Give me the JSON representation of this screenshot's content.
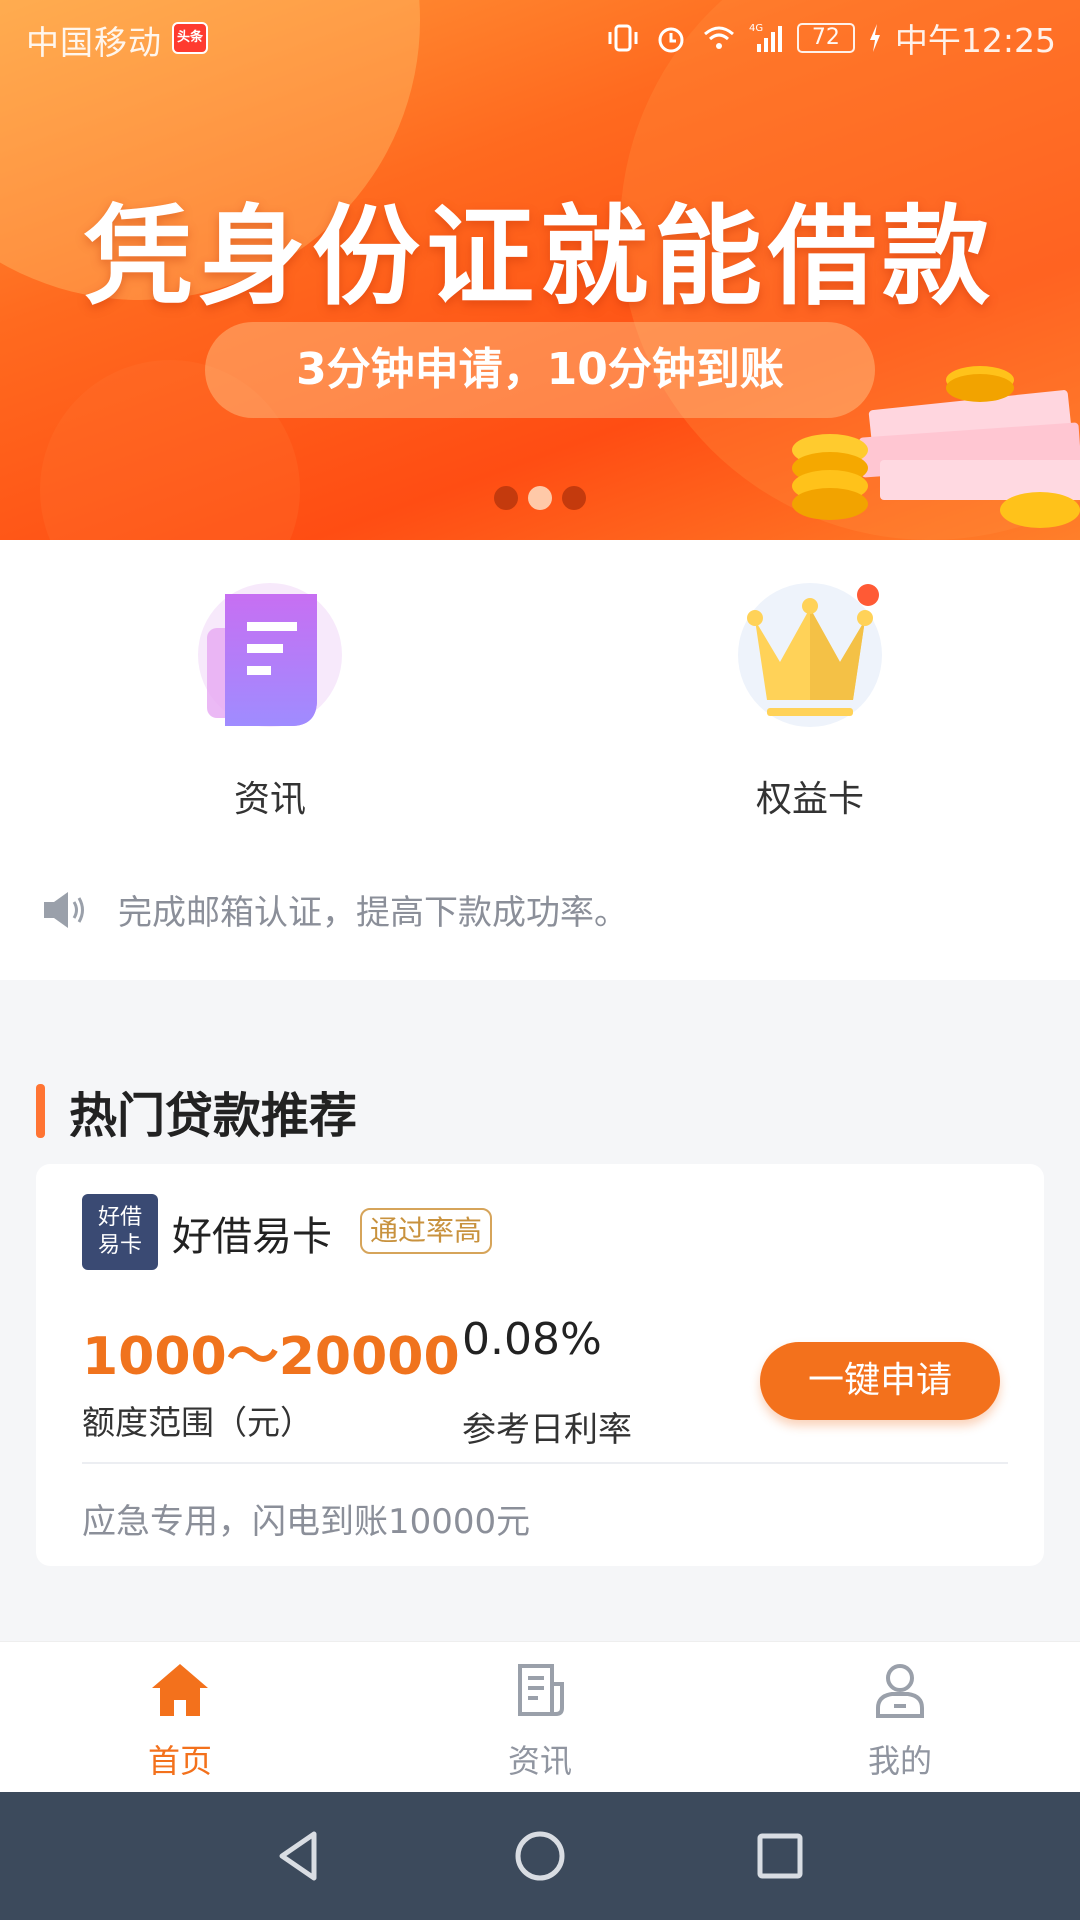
{
  "status_bar": {
    "carrier": "中国移动",
    "carrier_badge": "头条",
    "network": "4G",
    "battery": "72",
    "time": "中午12:25"
  },
  "banner": {
    "title": "凭身份证就能借款",
    "subtitle": "3分钟申请，10分钟到账",
    "active_dot": 1,
    "dot_count": 3
  },
  "quick_entries": [
    {
      "label": "资讯",
      "icon": "document-icon"
    },
    {
      "label": "权益卡",
      "icon": "crown-icon",
      "badge": true
    }
  ],
  "notice": {
    "icon": "speaker-icon",
    "text": "完成邮箱认证，提高下款成功率。"
  },
  "hot_loans": {
    "section_title": "热门贷款推荐",
    "items": [
      {
        "logo_text_line1": "好借",
        "logo_text_line2": "易卡",
        "name": "好借易卡",
        "tag": "通过率高",
        "range_value": "1000～20000",
        "range_label": "额度范围（元）",
        "rate_value": "0.08%",
        "rate_label": "参考日利率",
        "apply_label": "一键申请",
        "description": "应急专用，闪电到账10000元"
      }
    ]
  },
  "bottom_nav": {
    "items": [
      {
        "label": "首页",
        "icon": "home-icon",
        "active": true
      },
      {
        "label": "资讯",
        "icon": "news-icon",
        "active": false
      },
      {
        "label": "我的",
        "icon": "user-icon",
        "active": false
      }
    ]
  },
  "colors": {
    "accent": "#f3711c",
    "banner_orange": "#ff5a1a",
    "system_nav": "#3c4a5c"
  }
}
